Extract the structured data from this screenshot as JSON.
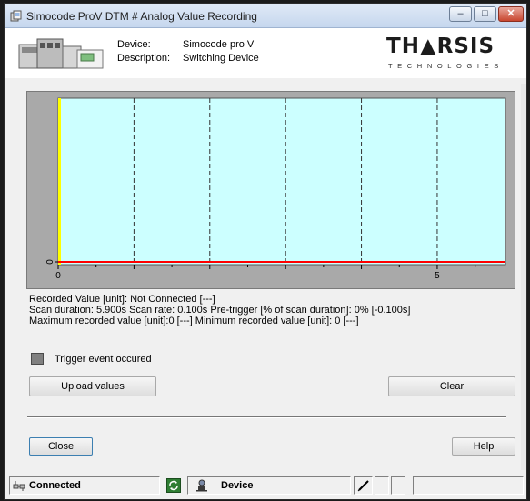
{
  "window": {
    "title": "Simocode ProV DTM # Analog Value Recording",
    "controls": {
      "minimize": "–",
      "maximize": "□",
      "close": "✕"
    }
  },
  "header": {
    "device_label": "Device:",
    "device_value": "Simocode pro V",
    "description_label": "Description:",
    "description_value": "Switching Device",
    "logo_text": "TH▲RSIS",
    "logo_sub": "TECHNOLOGIES"
  },
  "chart_data": {
    "type": "line",
    "x_ticks": [
      "0",
      "5"
    ],
    "y_ticks": [
      "0"
    ],
    "xlim": [
      0,
      5.9
    ],
    "grid": "vertical-dashed",
    "series": [
      {
        "color": "#ff0000",
        "x": [
          0,
          5.9
        ],
        "y": [
          0,
          0
        ]
      }
    ],
    "colors": {
      "plot_bg": "#ccffff",
      "outer_bg": "#a9a9a9",
      "cursor": "#ffff00"
    }
  },
  "info": {
    "recorded_value": "Recorded Value [unit]: Not Connected [---]",
    "scan_line": "Scan duration: 5.900s    Scan rate: 0.100s    Pre-trigger [% of scan duration]: 0% [-0.100s]",
    "minmax_line": "Maximum recorded value [unit]:0 [---]    Minimum recorded value [unit]: 0 [---]"
  },
  "trigger": {
    "label": "Trigger event occured"
  },
  "buttons": {
    "upload": "Upload values",
    "clear": "Clear",
    "close": "Close",
    "help": "Help"
  },
  "statusbar": {
    "connection": "Connected",
    "mode": "Device"
  }
}
